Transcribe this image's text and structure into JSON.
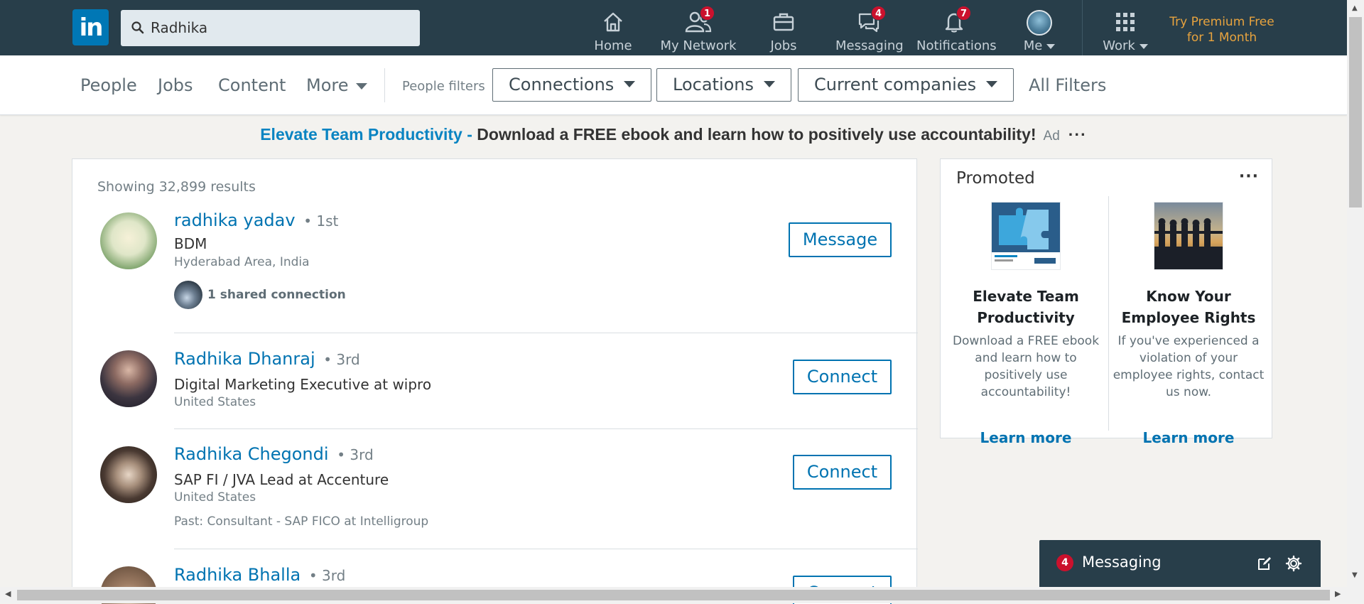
{
  "nav": {
    "logo_text": "in",
    "search_value": "Radhika",
    "items": [
      {
        "label": "Home",
        "icon": "home-icon",
        "badge": ""
      },
      {
        "label": "My Network",
        "icon": "network-icon",
        "badge": "1"
      },
      {
        "label": "Jobs",
        "icon": "briefcase-icon",
        "badge": ""
      },
      {
        "label": "Messaging",
        "icon": "messaging-icon",
        "badge": "4"
      },
      {
        "label": "Notifications",
        "icon": "bell-icon",
        "badge": "7"
      },
      {
        "label": "Me",
        "icon": "avatar",
        "badge": ""
      },
      {
        "label": "Work",
        "icon": "grid-icon",
        "badge": ""
      }
    ],
    "premium_line1": "Try Premium Free",
    "premium_line2": "for 1 Month"
  },
  "filters": {
    "tabs": [
      "People",
      "Jobs",
      "Content",
      "More"
    ],
    "people_filters_label": "People filters",
    "buttons": [
      "Connections",
      "Locations",
      "Current companies"
    ],
    "all_filters": "All Filters"
  },
  "ad": {
    "headline": "Elevate Team Productivity - ",
    "text": "Download a FREE ebook and learn how to positively use accountability!",
    "tag": "Ad",
    "dots": "···"
  },
  "results": {
    "showing": "Showing 32,899 results",
    "people": [
      {
        "name": "radhika yadav",
        "degree": "• 1st",
        "title": "BDM",
        "location": "Hyderabad Area, India",
        "extra": "",
        "shared": "1 shared connection",
        "action": "Message"
      },
      {
        "name": "Radhika Dhanraj",
        "degree": "• 3rd",
        "title": "Digital Marketing Executive at wipro",
        "location": "United States",
        "extra": "",
        "shared": "",
        "action": "Connect"
      },
      {
        "name": "Radhika Chegondi",
        "degree": "• 3rd",
        "title": "SAP FI / JVA Lead at Accenture",
        "location": "United States",
        "extra": "Past: Consultant - SAP FICO at Intelligroup",
        "shared": "",
        "action": "Connect"
      },
      {
        "name": "Radhika Bhalla",
        "degree": "• 3rd",
        "title": "",
        "location": "",
        "extra": "",
        "shared": "",
        "action": "Connect"
      }
    ]
  },
  "promoted": {
    "title": "Promoted",
    "dots": "···",
    "ads": [
      {
        "headline": "Elevate Team Productivity",
        "desc": "Download a FREE ebook and learn how to positively use accountability!",
        "cta": "Learn more"
      },
      {
        "headline": "Know Your Employee Rights",
        "desc": "If you've experienced a violation of your employee rights, contact us now.",
        "cta": "Learn more"
      }
    ]
  },
  "messaging_dock": {
    "badge": "4",
    "label": "Messaging"
  },
  "colors": {
    "nav_bg": "#283e4a",
    "link_blue": "#0073b1",
    "badge_red": "#cb112d",
    "premium_gold": "#e7a33e"
  }
}
